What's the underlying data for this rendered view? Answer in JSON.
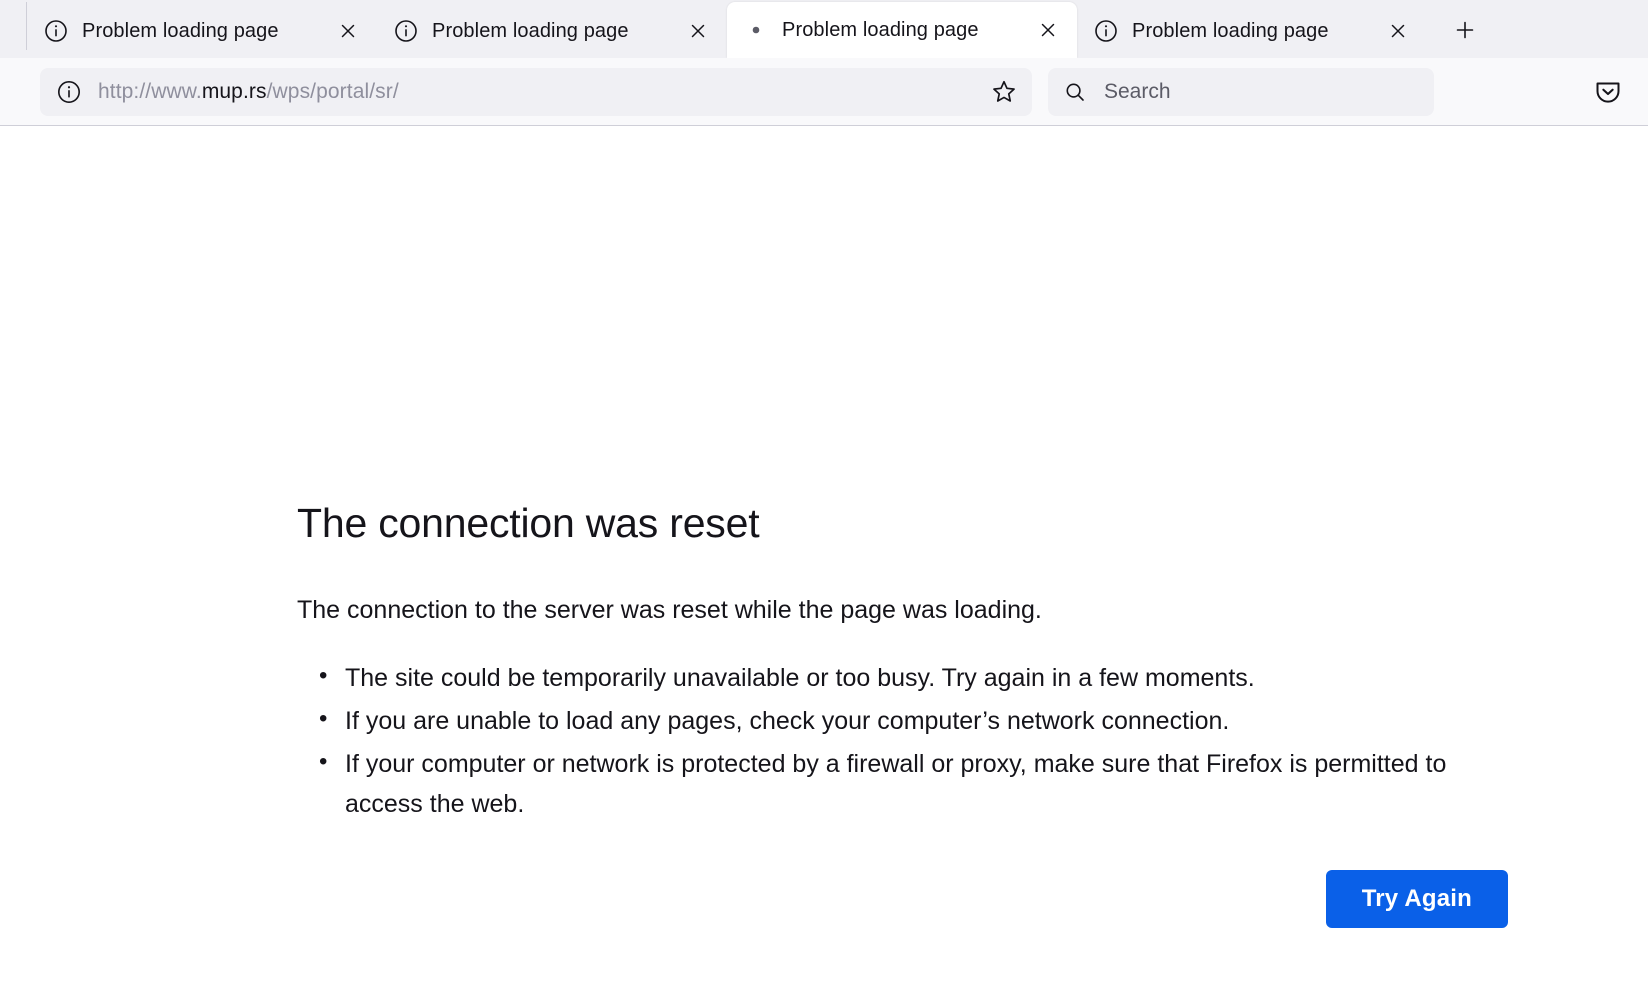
{
  "browser": {
    "tabs": [
      {
        "title": "Problem loading page",
        "icon": "info-circle-icon",
        "active": false
      },
      {
        "title": "Problem loading page",
        "icon": "info-circle-icon",
        "active": false
      },
      {
        "title": "Problem loading page",
        "icon": "loading-dot-icon",
        "active": true
      },
      {
        "title": "Problem loading page",
        "icon": "info-circle-icon",
        "active": false
      }
    ],
    "new_tab_label": "+",
    "toolbar": {
      "url_prefix": "http://www.",
      "url_host": "mup.rs",
      "url_path": "/wps/portal/sr/",
      "identity_icon": "info-circle-icon",
      "bookmark_icon": "star-icon",
      "pocket_icon": "pocket-icon"
    },
    "search": {
      "placeholder": "Search",
      "icon": "magnifier-icon"
    }
  },
  "error_page": {
    "title": "The connection was reset",
    "description": "The connection to the server was reset while the page was loading.",
    "suggestions": [
      "The site could be temporarily unavailable or too busy. Try again in a few moments.",
      "If you are unable to load any pages, check your computer’s network connection.",
      "If your computer or network is protected by a firewall or proxy, make sure that Firefox is permitted to access the web."
    ],
    "retry_button": "Try Again"
  },
  "colors": {
    "accent": "#0a60e8",
    "tabbar_bg": "#f0f0f4",
    "toolbar_bg": "#f9f9fb",
    "text": "#15141a",
    "muted_text": "#8f8f9d"
  }
}
